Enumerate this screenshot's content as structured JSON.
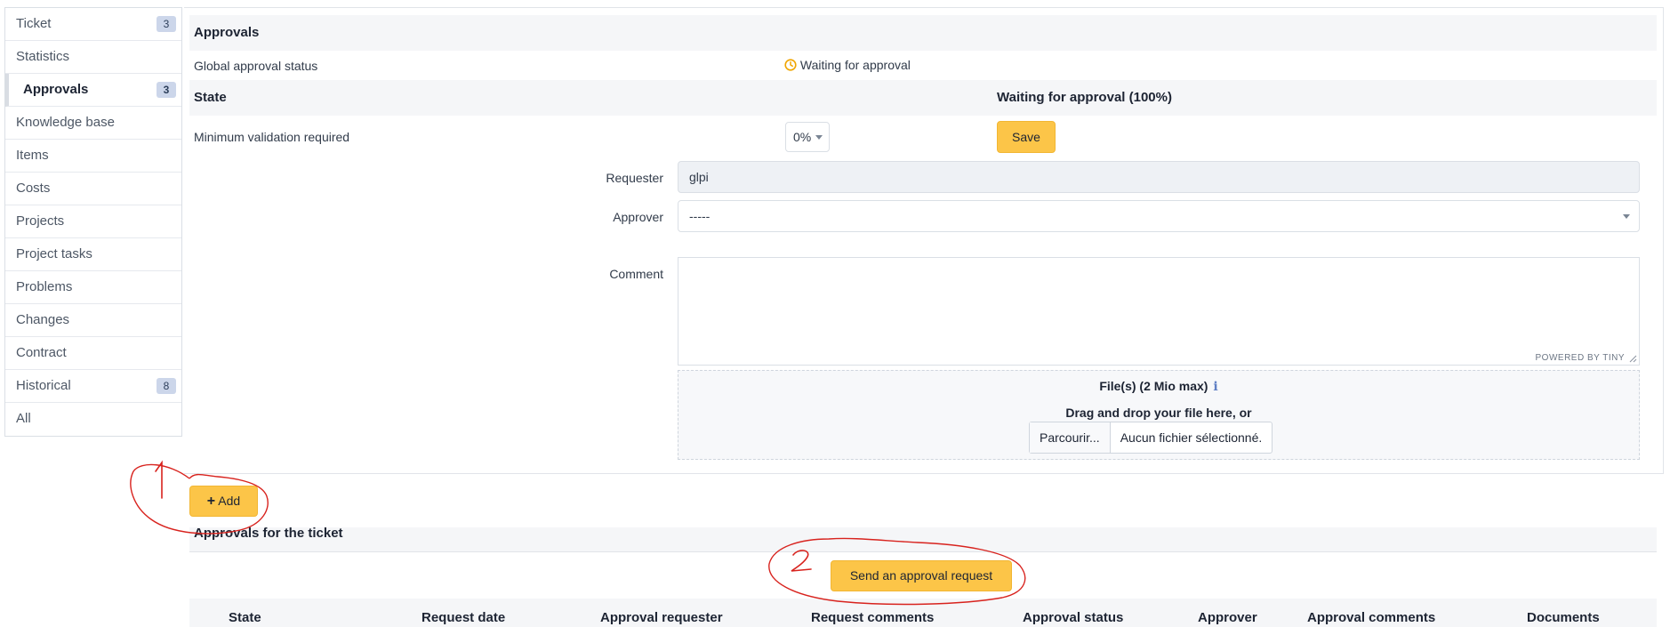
{
  "sidebar": {
    "items": [
      {
        "label": "Ticket",
        "badge": "3"
      },
      {
        "label": "Statistics",
        "badge": ""
      },
      {
        "label": "Approvals",
        "badge": "3"
      },
      {
        "label": "Knowledge base",
        "badge": ""
      },
      {
        "label": "Items",
        "badge": ""
      },
      {
        "label": "Costs",
        "badge": ""
      },
      {
        "label": "Projects",
        "badge": ""
      },
      {
        "label": "Project tasks",
        "badge": ""
      },
      {
        "label": "Problems",
        "badge": ""
      },
      {
        "label": "Changes",
        "badge": ""
      },
      {
        "label": "Contract",
        "badge": ""
      },
      {
        "label": "Historical",
        "badge": "8"
      },
      {
        "label": "All",
        "badge": ""
      }
    ],
    "active": "Approvals"
  },
  "approvals": {
    "title": "Approvals",
    "global_status_label": "Global approval status",
    "global_status_value": "Waiting for approval",
    "state_label": "State",
    "state_value": "Waiting for approval (100%)",
    "min_validation_label": "Minimum validation required",
    "min_validation_value": "0%",
    "save_label": "Save"
  },
  "form": {
    "requester_label": "Requester",
    "requester_value": "glpi",
    "approver_label": "Approver",
    "approver_value": "-----",
    "comment_label": "Comment",
    "powered_by": "POWERED BY TINY",
    "files_title": "File(s) (2 Mio max)",
    "drag_text": "Drag and drop your file here, or",
    "browse_label": "Parcourir...",
    "no_file_label": "Aucun fichier sélectionné."
  },
  "actions": {
    "add_label": "Add",
    "send_label": "Send an approval request"
  },
  "list": {
    "title": "Approvals for the ticket",
    "columns": [
      "State",
      "Request date",
      "Approval requester",
      "Request comments",
      "Approval status",
      "Approver",
      "Approval comments",
      "Documents"
    ]
  },
  "annotations": {
    "mark_1": "1",
    "mark_2": "2"
  },
  "colors": {
    "accent_button": "#fcc548",
    "status_icon": "#f0a500",
    "annotation_red": "#d8231e",
    "badge_bg": "#ccd6ea"
  },
  "icons": {
    "status": "clock-icon",
    "add": "plus-icon",
    "info": "info-icon",
    "approver_dropdown": "chevron-down-icon"
  }
}
